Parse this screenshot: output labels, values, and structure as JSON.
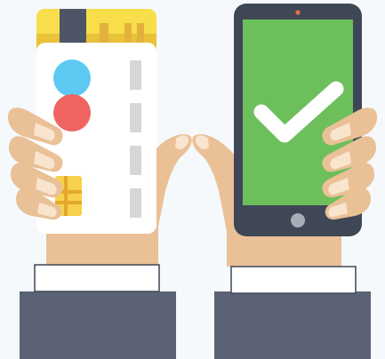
{
  "illustration": {
    "icon": "mobile-payment-illustration",
    "card": {
      "icon": "credit-card-icon",
      "chip_icon": "card-chip-icon",
      "logo_icon": "card-logo-circles-icon"
    },
    "phone": {
      "icon": "smartphone-icon",
      "status": "payment-approved",
      "status_icon": "checkmark-icon"
    }
  },
  "colors": {
    "background": "#F5F9FC",
    "sleeve": "#5A6274",
    "cuff": "#FFFFFF",
    "skin": "#EAC096",
    "skin_light": "#F7D9B8",
    "nail": "#F9E4CE",
    "card_body": "#FFFFFF",
    "card_gold": "#F7DE4A",
    "card_stripe": "#4D5566",
    "card_circle_blue": "#5BC9F2",
    "card_circle_red": "#EF6461",
    "card_chip": "#F7D14C",
    "phone_body": "#3F4756",
    "phone_screen": "#6DBF5C",
    "checkmark": "#FFFFFF",
    "phone_camera": "#E8714E",
    "phone_button": "#A8AEB8"
  }
}
